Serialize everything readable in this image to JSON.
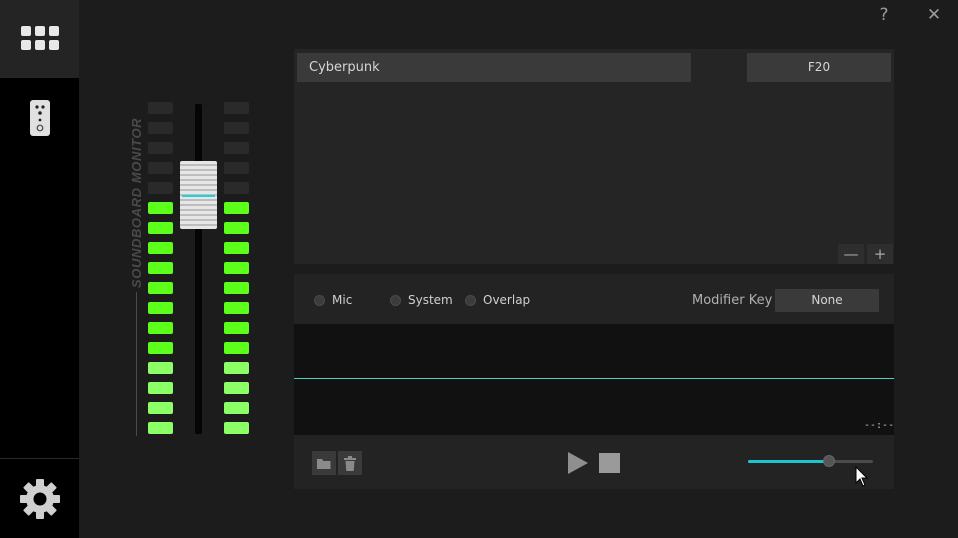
{
  "window": {
    "help_label": "?",
    "close_label": "✕"
  },
  "nav": {
    "items": [
      {
        "icon": "grid-icon"
      },
      {
        "icon": "remote-icon"
      },
      {
        "icon": "gear-icon"
      }
    ]
  },
  "monitor": {
    "label": "SOUNDBOARD MONITOR",
    "segments": 17,
    "active_segments": 12,
    "fader_level": 0.72,
    "colors": {
      "bright": "#5bff1a",
      "dim": "#8cff66",
      "off": "#2a2a2a",
      "accent": "#22d1d8"
    }
  },
  "sound_list": {
    "rows": [
      {
        "name": "Cyberpunk",
        "key": "F20"
      }
    ],
    "remove_label": "—",
    "add_label": "+"
  },
  "detail": {
    "options": [
      {
        "label": "Mic"
      },
      {
        "label": "System"
      },
      {
        "label": "Overlap"
      }
    ],
    "modifier_label": "Modifier Key",
    "modifier_value": "None",
    "time_display": "--:--",
    "volume": 0.65,
    "accent_color": "#1fc3cb"
  }
}
